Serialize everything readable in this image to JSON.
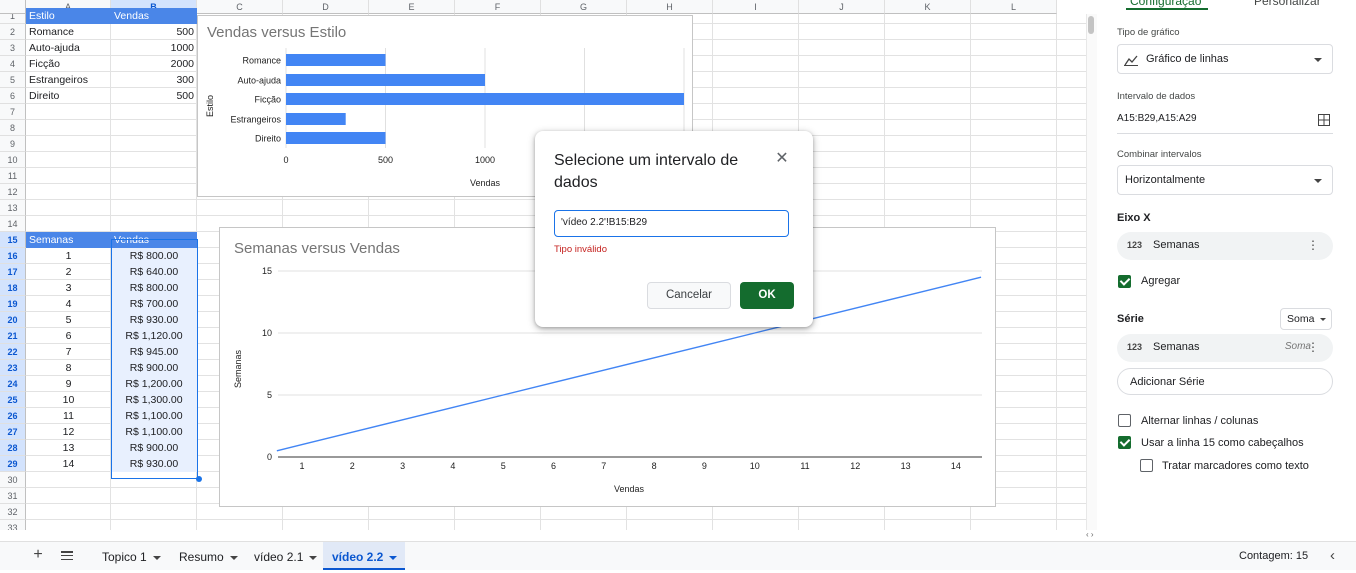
{
  "columns": [
    "A",
    "B",
    "C",
    "D",
    "E",
    "F",
    "G",
    "H",
    "I",
    "J",
    "K",
    "L"
  ],
  "table1": {
    "headers": [
      "Estilo",
      "Vendas"
    ],
    "rows": [
      {
        "estilo": "Romance",
        "vendas": "500"
      },
      {
        "estilo": "Auto-ajuda",
        "vendas": "1000"
      },
      {
        "estilo": "Ficção",
        "vendas": "2000"
      },
      {
        "estilo": "Estrangeiros",
        "vendas": "300"
      },
      {
        "estilo": "Direito",
        "vendas": "500"
      }
    ]
  },
  "table2": {
    "headers": [
      "Semanas",
      "Vendas"
    ],
    "rows": [
      {
        "semana": "1",
        "vendas": "R$ 800.00"
      },
      {
        "semana": "2",
        "vendas": "R$ 640.00"
      },
      {
        "semana": "3",
        "vendas": "R$ 800.00"
      },
      {
        "semana": "4",
        "vendas": "R$ 700.00"
      },
      {
        "semana": "5",
        "vendas": "R$ 930.00"
      },
      {
        "semana": "6",
        "vendas": "R$ 1,120.00"
      },
      {
        "semana": "7",
        "vendas": "R$ 945.00"
      },
      {
        "semana": "8",
        "vendas": "R$ 900.00"
      },
      {
        "semana": "9",
        "vendas": "R$ 1,200.00"
      },
      {
        "semana": "10",
        "vendas": "R$ 1,300.00"
      },
      {
        "semana": "11",
        "vendas": "R$ 1,100.00"
      },
      {
        "semana": "12",
        "vendas": "R$ 1,100.00"
      },
      {
        "semana": "13",
        "vendas": "R$ 900.00"
      },
      {
        "semana": "14",
        "vendas": "R$ 930.00"
      }
    ]
  },
  "chart_data": [
    {
      "type": "bar",
      "orientation": "horizontal",
      "title": "Vendas versus Estilo",
      "categories": [
        "Romance",
        "Auto-ajuda",
        "Ficção",
        "Estrangeiros",
        "Direito"
      ],
      "values": [
        500,
        1000,
        2000,
        300,
        500
      ],
      "xlabel": "Vendas",
      "ylabel": "Estilo",
      "xticks": [
        "0",
        "500",
        "1000"
      ],
      "color": "#4285f4"
    },
    {
      "type": "line",
      "title": "Semanas versus Vendas",
      "x": [
        1,
        2,
        3,
        4,
        5,
        6,
        7,
        8,
        9,
        10,
        11,
        12,
        13,
        14
      ],
      "values": [
        1,
        2,
        3,
        4,
        5,
        6,
        7,
        8,
        9,
        10,
        11,
        12,
        13,
        14
      ],
      "xlabel": "Vendas",
      "ylabel": "Semanas",
      "ylim": [
        0,
        15
      ],
      "yticks": [
        "0",
        "5",
        "10",
        "15"
      ],
      "xticks": [
        "1",
        "2",
        "3",
        "4",
        "5",
        "6",
        "7",
        "8",
        "9",
        "10",
        "11",
        "12",
        "13",
        "14"
      ],
      "color": "#4285f4"
    }
  ],
  "dialog": {
    "title": "Selecione um intervalo de dados",
    "input_value": "'vídeo 2.2'!B15:B29",
    "error": "Tipo inválido",
    "cancel": "Cancelar",
    "ok": "OK"
  },
  "panel": {
    "tab_setup": "Configuração",
    "tab_customize": "Personalizar",
    "chart_type_label": "Tipo de gráfico",
    "chart_type_value": "Gráfico de linhas",
    "data_range_label": "Intervalo de dados",
    "data_range_value": "A15:B29,A15:A29",
    "combine_label": "Combinar intervalos",
    "combine_value": "Horizontalmente",
    "x_axis_title": "Eixo X",
    "x_axis_chip": "Semanas",
    "aggregate_label": "Agregar",
    "series_title": "Série",
    "series_agg": "Soma",
    "series_chip": "Semanas",
    "series_chip_agg": "Soma",
    "add_series": "Adicionar Série",
    "switch_rows": "Alternar linhas / colunas",
    "use_row_headers": "Usar a linha 15 como cabeçalhos",
    "treat_labels": "Tratar marcadores como texto",
    "num_icon": "123"
  },
  "sheets": [
    {
      "name": "Topico 1",
      "active": false
    },
    {
      "name": "Resumo",
      "active": false
    },
    {
      "name": "vídeo 2.1",
      "active": false
    },
    {
      "name": "vídeo 2.2",
      "active": true
    }
  ],
  "status": {
    "count": "Contagem: 15"
  },
  "icons": {
    "add_sheet": "plus-icon",
    "sheet_list": "menu-icon",
    "collapse": "chevron-left-icon",
    "close": "close-icon",
    "grid_select": "grid-icon",
    "line_chart": "line-chart-icon"
  }
}
